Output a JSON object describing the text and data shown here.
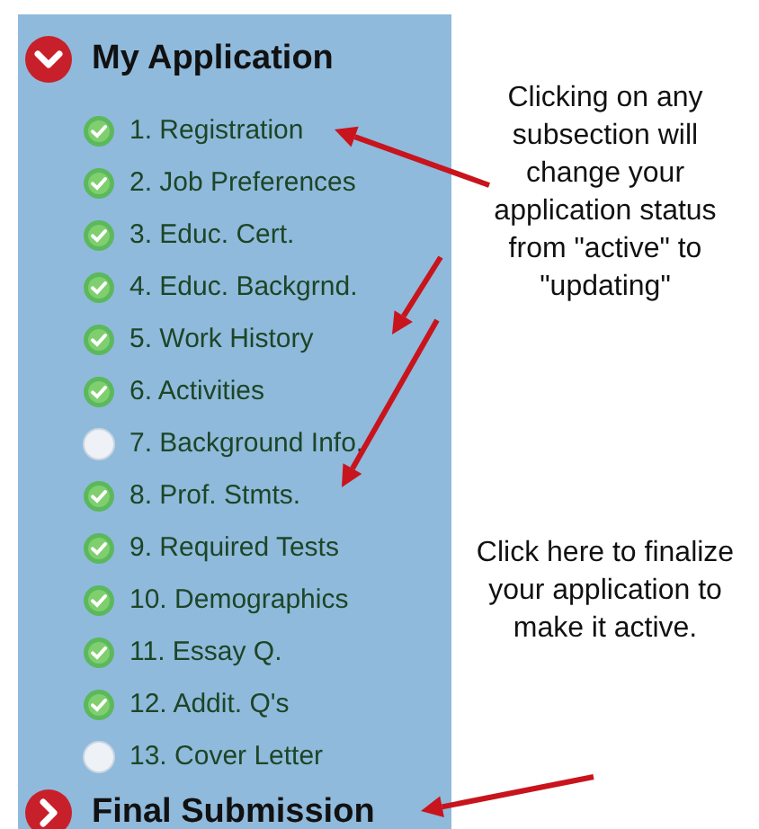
{
  "my_application": {
    "title": "My Application",
    "expanded": true,
    "items": [
      {
        "label": "1. Registration",
        "completed": true
      },
      {
        "label": "2. Job Preferences",
        "completed": true
      },
      {
        "label": "3. Educ. Cert.",
        "completed": true
      },
      {
        "label": "4. Educ. Backgrnd.",
        "completed": true
      },
      {
        "label": "5. Work History",
        "completed": true
      },
      {
        "label": "6. Activities",
        "completed": true
      },
      {
        "label": "7. Background Info.",
        "completed": false
      },
      {
        "label": "8. Prof. Stmts.",
        "completed": true
      },
      {
        "label": "9. Required Tests",
        "completed": true
      },
      {
        "label": "10. Demographics",
        "completed": true
      },
      {
        "label": "11. Essay Q.",
        "completed": true
      },
      {
        "label": "12. Addit. Q's",
        "completed": true
      },
      {
        "label": "13. Cover Letter",
        "completed": false
      }
    ]
  },
  "final_submission": {
    "title": "Final Submission",
    "expanded": false
  },
  "notes": [
    "Clicking on any subsection will change your application status from \"active\" to \"updating\"",
    "Click here to finalize your application to make it active."
  ]
}
